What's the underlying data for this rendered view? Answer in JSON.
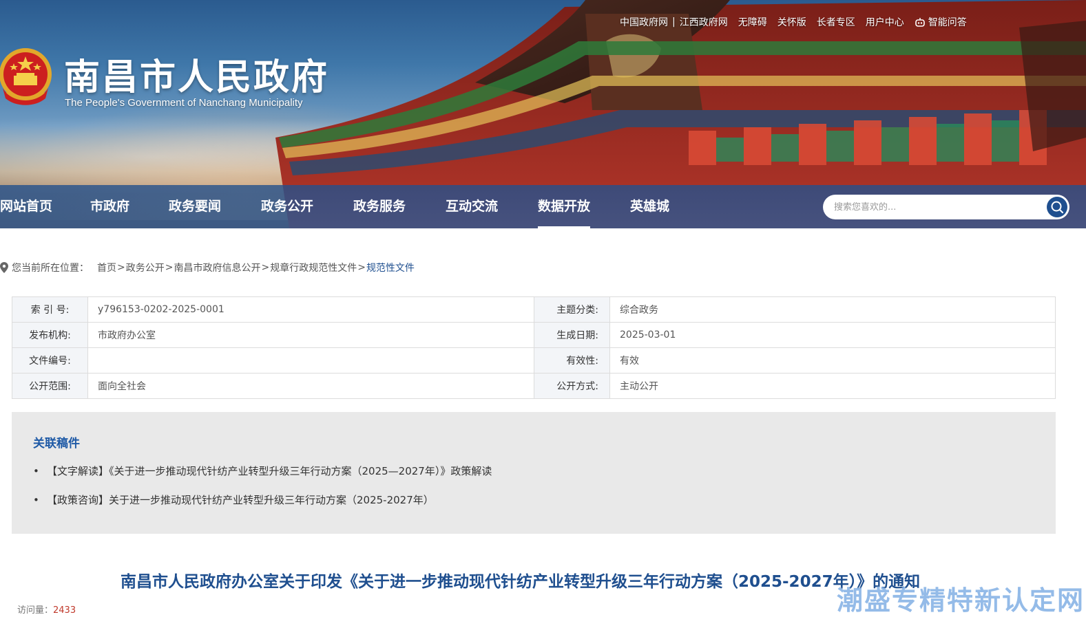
{
  "topbar": {
    "links": [
      "中国政府网",
      "江西政府网",
      "无障碍",
      "关怀版",
      "长者专区",
      "用户中心",
      "智能问答"
    ]
  },
  "header": {
    "title": "南昌市人民政府",
    "subtitle": "The People's Government of Nanchang Municipality"
  },
  "nav": {
    "items": [
      "网站首页",
      "市政府",
      "政务要闻",
      "政务公开",
      "政务服务",
      "互动交流",
      "数据开放",
      "英雄城"
    ],
    "active_index": 6
  },
  "search": {
    "placeholder": "搜索您喜欢的..."
  },
  "breadcrumb": {
    "label": "您当前所在位置：",
    "items": [
      "首页",
      "政务公开",
      "南昌市政府信息公开",
      "规章行政规范性文件",
      "规范性文件"
    ]
  },
  "meta": {
    "rows": [
      {
        "k1": "索 引 号:",
        "v1": "y796153-0202-2025-0001",
        "k2": "主题分类:",
        "v2": "综合政务"
      },
      {
        "k1": "发布机构:",
        "v1": "市政府办公室",
        "k2": "生成日期:",
        "v2": "2025-03-01"
      },
      {
        "k1": "文件编号:",
        "v1": "",
        "k2": "有效性:",
        "v2": "有效"
      },
      {
        "k1": "公开范围:",
        "v1": "面向全社会",
        "k2": "公开方式:",
        "v2": "主动公开"
      }
    ]
  },
  "related": {
    "title": "关联稿件",
    "items": [
      "【文字解读】《关于进一步推动现代针纺产业转型升级三年行动方案（2025—2027年）》政策解读",
      "【政策咨询】关于进一步推动现代针纺产业转型升级三年行动方案（2025-2027年）"
    ]
  },
  "article": {
    "title": "南昌市人民政府办公室关于印发《关于进一步推动现代针纺产业转型升级三年行动方案（2025-2027年）》的通知",
    "visits_label": "访问量：",
    "visits_value": "2433"
  },
  "watermark": "潮盛专精特新认定网",
  "colors": {
    "nav_bg": "#2d5a94",
    "accent": "#1f4f8f",
    "related_title": "#1f5aa6",
    "related_bg": "#e9e9e9"
  },
  "icons": {
    "emblem": "national-emblem-icon",
    "search": "search-icon",
    "location": "location-pin-icon",
    "robot": "robot-icon"
  }
}
